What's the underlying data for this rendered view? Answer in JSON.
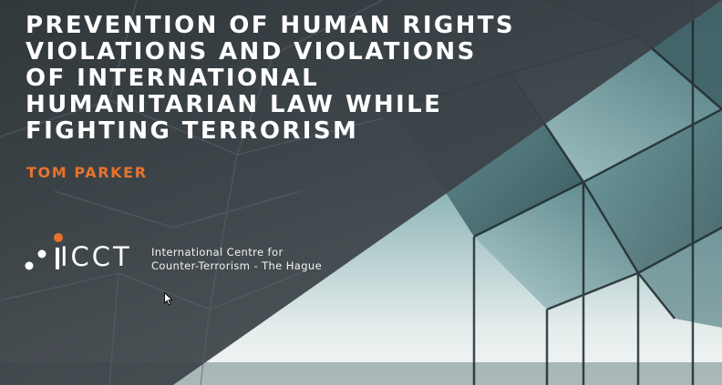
{
  "slide": {
    "title_lines": [
      "PREVENTION OF HUMAN RIGHTS",
      "VIOLATIONS AND VIOLATIONS",
      "OF INTERNATIONAL",
      "HUMANITARIAN LAW WHILE",
      "FIGHTING TERRORISM"
    ],
    "author": "TOM PARKER",
    "logo": {
      "wordmark": "ICCT",
      "org_lines": [
        "International Centre for",
        "Counter-Terrorism - The Hague"
      ]
    }
  },
  "colors": {
    "accent_orange": "#e8722c",
    "title_white": "#ffffff",
    "overlay_dark": "#2a2f33"
  },
  "icons": {
    "cursor": "mouse-pointer-icon",
    "logo_mark": "icct-dots-logo-icon"
  }
}
